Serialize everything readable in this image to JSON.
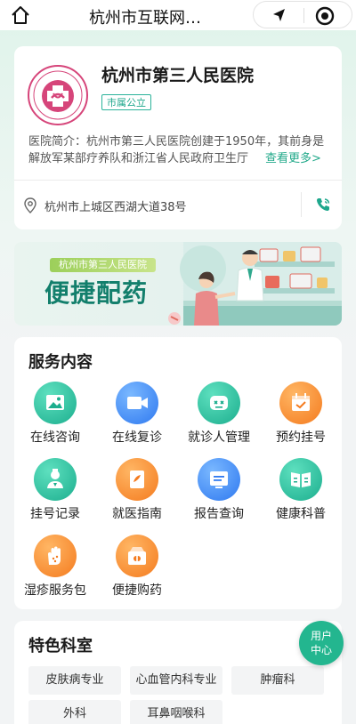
{
  "topbar": {
    "title": "杭州市互联网…",
    "icons": [
      "home-icon",
      "location-arrow-icon",
      "record-icon"
    ]
  },
  "hospital": {
    "name": "杭州市第三人民医院",
    "badge": "市属公立",
    "intro_prefix": "医院简介：",
    "intro": "杭州市第三人民医院创建于1950年，其前身是解放军某部疗养队和浙江省人民政府卫生厅",
    "more": "查看更多>",
    "address": "杭州市上城区西湖大道38号"
  },
  "banner": {
    "subtitle": "杭州市第三人民医院",
    "title": "便捷配药"
  },
  "services": {
    "title": "服务内容",
    "items": [
      {
        "label": "在线咨询",
        "icon": "image-icon",
        "color": "#1cae8e"
      },
      {
        "label": "在线复诊",
        "icon": "video-icon",
        "color": "#2f79f0"
      },
      {
        "label": "就诊人管理",
        "icon": "robot-icon",
        "color": "#1cae8e"
      },
      {
        "label": "预约挂号",
        "icon": "calendar-icon",
        "color": "#f47b1f"
      },
      {
        "label": "挂号记录",
        "icon": "doctor-icon",
        "color": "#1cae8e"
      },
      {
        "label": "就医指南",
        "icon": "guide-book-icon",
        "color": "#f47b1f"
      },
      {
        "label": "报告查询",
        "icon": "report-icon",
        "color": "#2f79f0"
      },
      {
        "label": "健康科普",
        "icon": "open-book-icon",
        "color": "#1cae8e"
      },
      {
        "label": "湿疹服务包",
        "icon": "hand-icon",
        "color": "#f47b1f"
      },
      {
        "label": "便捷购药",
        "icon": "medicine-box-icon",
        "color": "#f47b1f"
      }
    ]
  },
  "departments": {
    "title": "特色科室",
    "items": [
      "皮肤病专业",
      "心血管内科专业",
      "肿瘤科",
      "外科",
      "耳鼻咽喉科"
    ]
  },
  "user_center": {
    "line1": "用户",
    "line2": "中心"
  }
}
